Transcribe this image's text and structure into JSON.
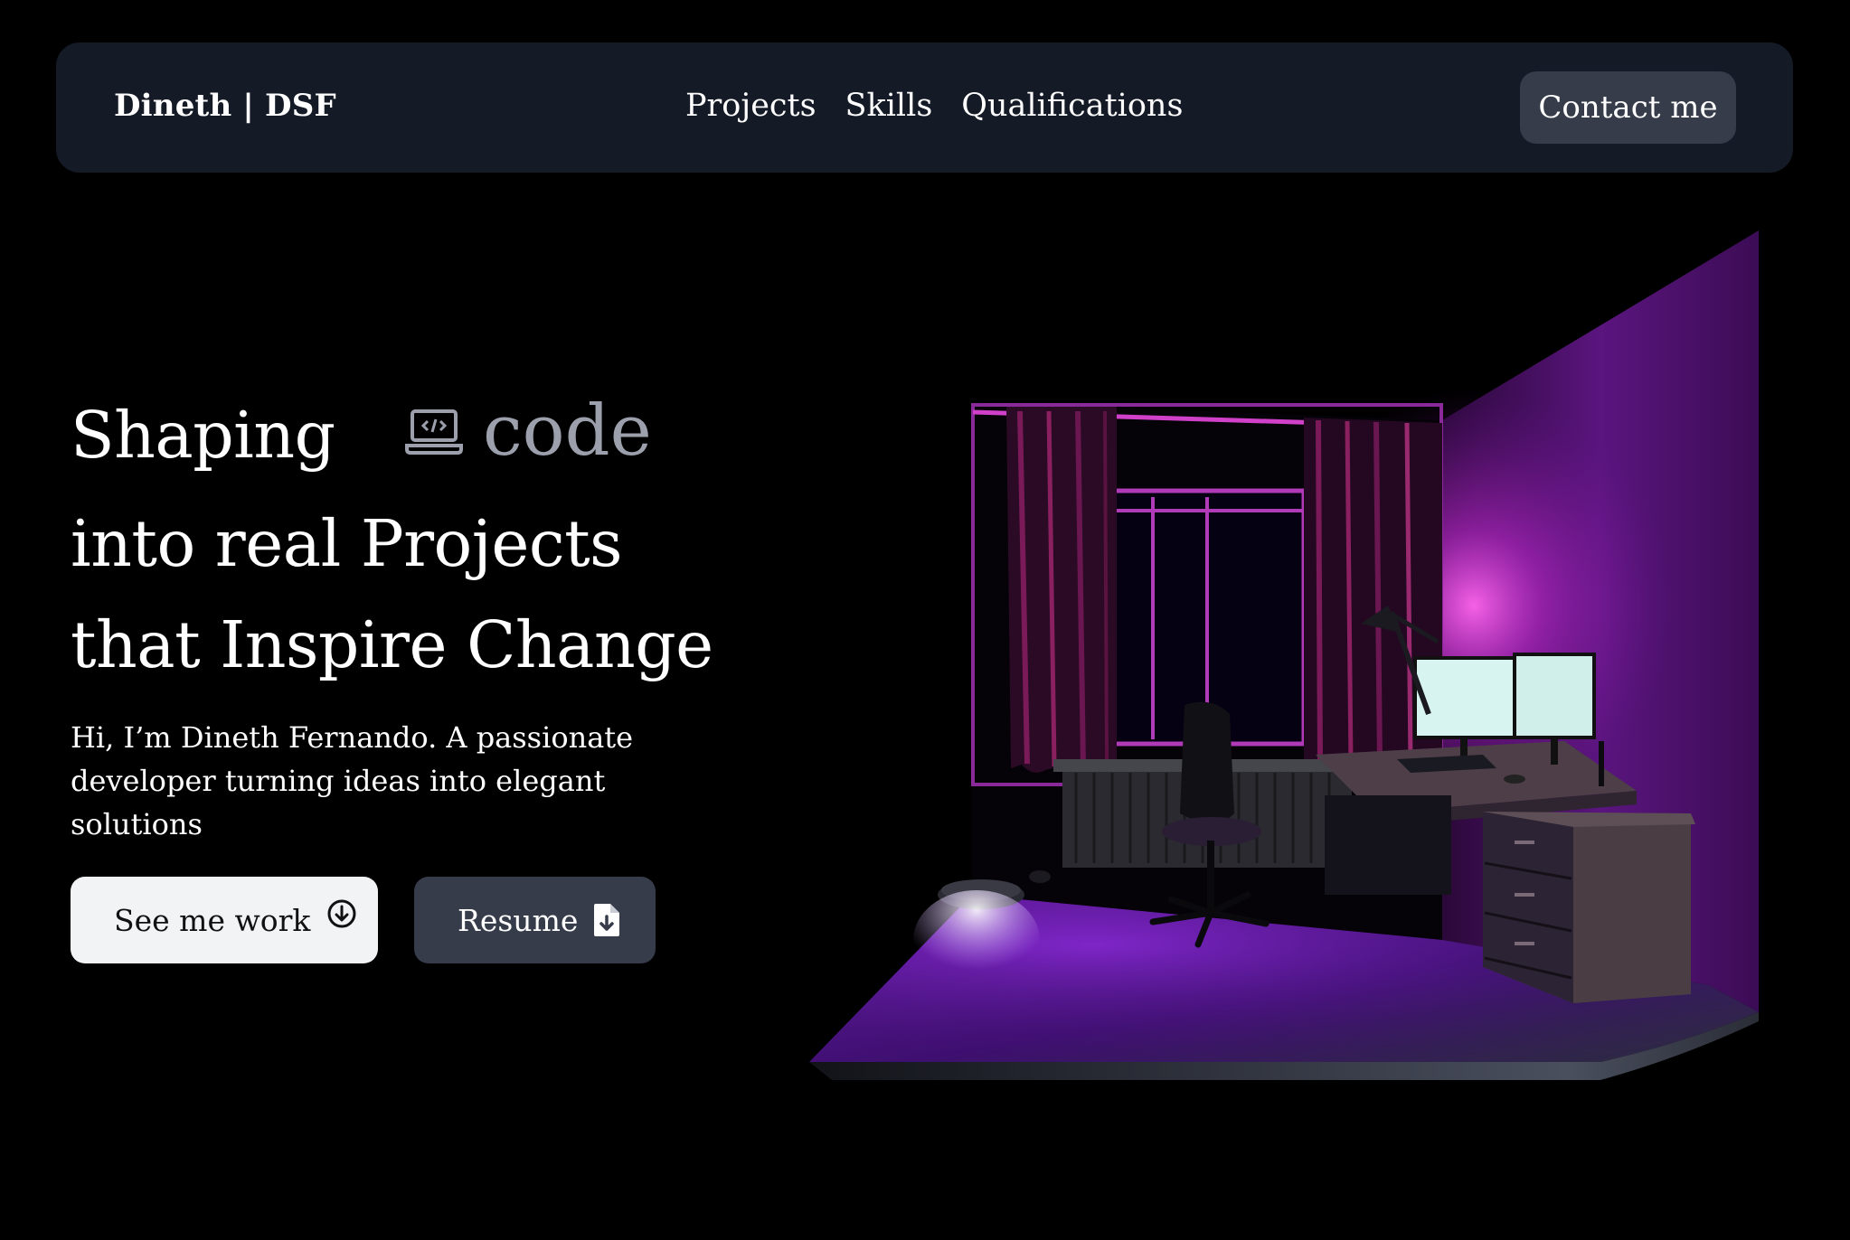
{
  "nav": {
    "brand": "Dineth | DSF",
    "links": [
      "Projects",
      "Skills",
      "Qualifications"
    ],
    "contact_label": "Contact me"
  },
  "hero": {
    "line1": "Shaping",
    "rotating_word": "code",
    "rotating_icon": "laptop-code-icon",
    "line2": "into real Projects",
    "line3": "that Inspire Change",
    "intro": "Hi, I’m Dineth Fernando. A passionate developer turning ideas into elegant solutions",
    "primary_button": "See me work",
    "primary_icon": "arrow-down-circle-icon",
    "secondary_button": "Resume",
    "secondary_icon": "file-download-icon"
  },
  "colors": {
    "background": "#000000",
    "navbar": "#141a26",
    "button_dark": "#363c4a",
    "button_light": "#f2f3f5",
    "muted_text": "#9ba0ac",
    "accent_purple": "#7a1fb0",
    "accent_pink": "#e040d0"
  }
}
